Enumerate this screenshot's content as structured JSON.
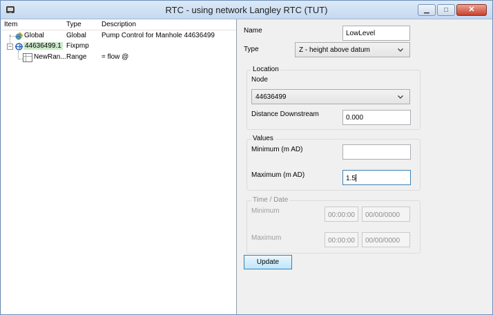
{
  "window": {
    "title": "RTC -  using network Langley RTC (TUT)",
    "icons": {
      "app": "rtc-app-icon",
      "minimize": "minimize-icon",
      "maximize": "maximize-icon",
      "close": "close-icon"
    }
  },
  "tree": {
    "columns": [
      "Item",
      "Type",
      "Description"
    ],
    "rows": [
      {
        "item": "Global",
        "type": "Global",
        "description": "Pump Control for Manhole 44636499",
        "icon": "global-icon"
      },
      {
        "item": "44636499.1",
        "type": "Fixpmp",
        "description": "",
        "icon": "pump-icon",
        "selected": true
      },
      {
        "item": "NewRan...",
        "type": "Range",
        "description": "= flow @",
        "icon": "range-icon"
      }
    ]
  },
  "form": {
    "name_label": "Name",
    "name_value": "LowLevel",
    "type_label": "Type",
    "type_value": "Z - height above datum",
    "location": {
      "legend": "Location",
      "node_label": "Node",
      "node_value": "44636499",
      "distance_label": "Distance Downstream",
      "distance_value": "0.000"
    },
    "values": {
      "legend": "Values",
      "minimum_label": "Minimum (m AD)",
      "minimum_value": "",
      "maximum_label": "Maximum (m AD)",
      "maximum_value": "1.5"
    },
    "time_date": {
      "legend": "Time / Date",
      "minimum_label": "Minimum",
      "minimum_time": "00:00:00",
      "minimum_date": "00/00/0000",
      "maximum_label": "Maximum",
      "maximum_time": "00:00:00",
      "maximum_date": "00/00/0000"
    },
    "update_label": "Update"
  },
  "colors": {
    "selection": "#cdeacb",
    "focus_border": "#3c7fb1",
    "close_button": "#c7402c"
  }
}
